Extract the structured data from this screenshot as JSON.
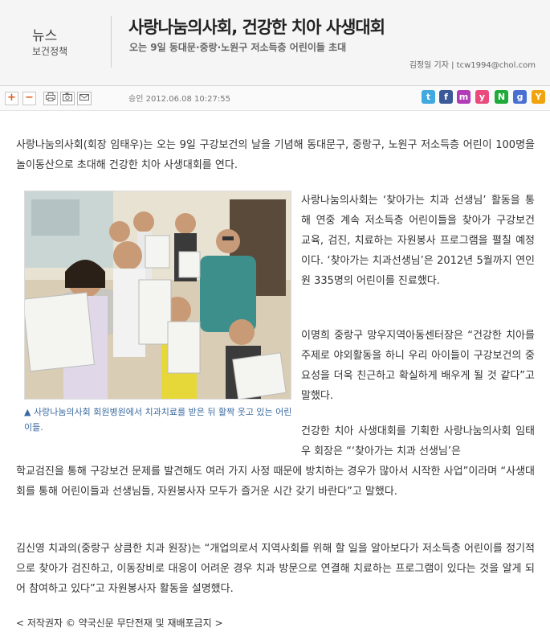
{
  "header": {
    "section_line1": "뉴스",
    "section_line2": "보건정책",
    "title": "사랑나눔의사회, 건강한 치아 사생대회",
    "subtitle": "오는 9일 동대문·중랑·노원구 저소득층 어린이들 초대",
    "byline": "김정일 기자 | tcw1994@chol.com"
  },
  "toolbar": {
    "font_increase": "+",
    "font_decrease": "−",
    "print_icon": "print-icon",
    "scrap_icon": "camera-icon",
    "email_icon": "mail-icon",
    "approved_date": "승인 2012.06.08  10:27:55",
    "sns": [
      {
        "name": "twitter-icon",
        "glyph": "t",
        "color": "#3fa9e0"
      },
      {
        "name": "facebook-icon",
        "glyph": "f",
        "color": "#3b5998"
      },
      {
        "name": "me2day-icon",
        "glyph": "m",
        "color": "#b23bb8"
      },
      {
        "name": "yozm-icon",
        "glyph": "y",
        "color": "#e94b7c"
      },
      {
        "name": "naver-icon",
        "glyph": "N",
        "color": "#1faa39"
      },
      {
        "name": "google-icon",
        "glyph": "g",
        "color": "#4a6fd3"
      },
      {
        "name": "yahoo-icon",
        "glyph": "Y",
        "color": "#f1a30e"
      }
    ]
  },
  "article": {
    "lead": "사랑나눔의사회(회장 임태우)는 오는 9일 구강보건의 날을 기념해 동대문구, 중랑구, 노원구 저소득층 어린이 100명을 놀이동산으로 초대해 건강한 치아 사생대회를 연다.",
    "p2": "사랑나눔의사회는 ‘찾아가는 치과 선생님’ 활동을 통해 연중 계속 저소득층 어린이들을 찾아가 구강보건 교육, 검진, 치료하는 자원봉사 프로그램을 펼칠 예정이다. ‘찾아가는 치과선생님’은 2012년 5월까지 연인원 335명의 어린이를 진료했다.",
    "p3": "이명희 중랑구 망우지역아동센터장은 “건강한 치아를 주제로 야외활동을 하니 우리 아이들이 구강보건의 중요성을 더욱 친근하고 확실하게 배우게 될 것 같다”고 말했다.",
    "p4_top": "건강한 치아 사생대회를 기획한 사랑나눔의사회 임태우 회장은 “‘찾아가는 치과 선생님’은",
    "p4_rest": "학교검진을 통해 구강보건 문제를 발견해도 여러 가지 사정 때문에 방치하는 경우가 많아서 시작한 사업”이라며 “사생대회를 통해 어린이들과 선생님들, 자원봉사자 모두가 즐거운 시간 갖기 바란다”고 말했다.",
    "p5": "김신영 치과의(중랑구 상큼한 치과 원장)는 “개업의로서 지역사회를 위해 할 일을 알아보다가 저소득층 어린이를 정기적으로 찾아가 검진하고, 이동장비로 대응이 어려운 경우 치과 방문으로 연결해 치료하는 프로그램이 있다는 것을 알게 되어 참여하고 있다”고 자원봉사자 활동을 설명했다.",
    "photo_caption": "▲ 사랑나눔의사회 회원병원에서 치과치료를 받은 뒤 활짝 웃고 있는 어린이들.",
    "copyright": "< 저작권자 © 약국신문 무단전재 및 재배포금지 >"
  }
}
